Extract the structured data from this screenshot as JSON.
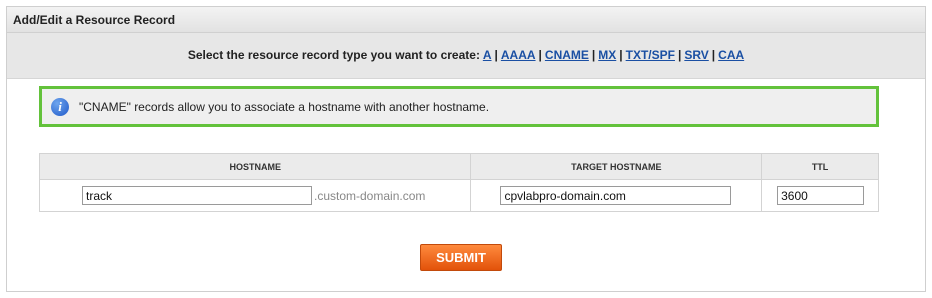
{
  "panel": {
    "title": "Add/Edit a Resource Record"
  },
  "type_selector": {
    "prompt": "Select the resource record type you want to create:",
    "types": [
      "A",
      "AAAA",
      "CNAME",
      "MX",
      "TXT/SPF",
      "SRV",
      "CAA"
    ],
    "separator": "|"
  },
  "info": {
    "icon": "info-icon",
    "text": "\"CNAME\" records allow you to associate a hostname with another hostname.",
    "border_color": "#63c23b"
  },
  "table": {
    "headers": {
      "hostname": "HOSTNAME",
      "target": "TARGET HOSTNAME",
      "ttl": "TTL"
    },
    "row": {
      "hostname_value": "track",
      "hostname_suffix": ".custom-domain.com",
      "target_value": "cpvlabpro-domain.com",
      "ttl_value": "3600"
    }
  },
  "submit": {
    "label": "SUBMIT",
    "color": "#f26a1b"
  }
}
